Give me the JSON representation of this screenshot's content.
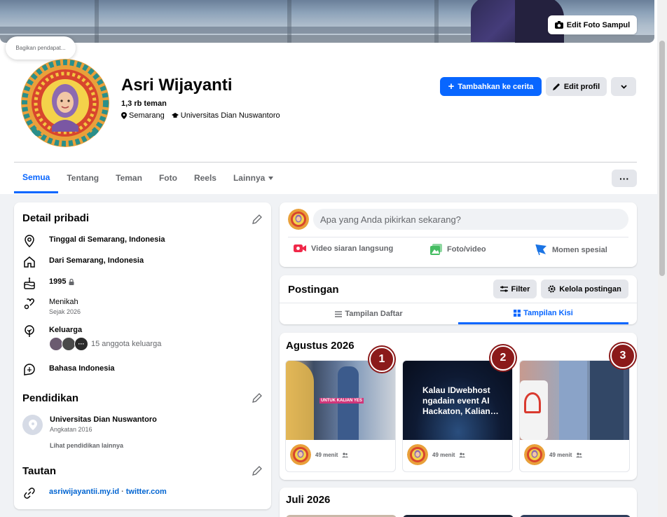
{
  "cover": {
    "edit_label": "Edit Foto Sampul"
  },
  "note": {
    "text": "Bagikan pendapat..."
  },
  "profile": {
    "name": "Asri Wijayanti",
    "friends": "1,3 rb teman",
    "location": "Semarang",
    "school": "Universitas Dian Nuswantoro"
  },
  "actions": {
    "add_story": "Tambahkan ke cerita",
    "edit_profile": "Edit profil"
  },
  "tabs": [
    "Semua",
    "Tentang",
    "Teman",
    "Foto",
    "Reels",
    "Lainnya"
  ],
  "details": {
    "title": "Detail pribadi",
    "lives": "Tinggal di Semarang, Indonesia",
    "from": "Dari Semarang, Indonesia",
    "birth_year": "1995",
    "relationship": "Menikah",
    "relationship_since": "Sejak 2026",
    "family_label": "Keluarga",
    "family_count": "15 anggota keluarga",
    "language": "Bahasa Indonesia"
  },
  "education": {
    "title": "Pendidikan",
    "school": "Universitas Dian Nuswantoro",
    "year": "Angkatan 2016",
    "more": "Lihat pendidikan lainnya"
  },
  "links": {
    "title": "Tautan",
    "link1": "asriwijayantii.my.id",
    "separator": "·",
    "link2": "twitter.com"
  },
  "composer": {
    "placeholder": "Apa yang Anda pikirkan sekarang?",
    "live": "Video siaran langsung",
    "photo": "Foto/video",
    "event": "Momen spesial"
  },
  "posts": {
    "title": "Postingan",
    "filter": "Filter",
    "manage": "Kelola postingan",
    "list_view": "Tampilan Daftar",
    "grid_view": "Tampilan Kisi"
  },
  "grid": {
    "month1": "Agustus 2026",
    "month2": "Juli 2026",
    "items": [
      {
        "badge": "1",
        "time": "49 menit",
        "caption": "UNTUK KALIAN YES"
      },
      {
        "badge": "2",
        "time": "49 menit",
        "caption": "Kalau IDwebhost ngadain event AI Hackaton, Kalian…"
      },
      {
        "badge": "3",
        "time": "49 menit",
        "caption": ""
      }
    ]
  },
  "colors": {
    "accent": "#0866ff",
    "badge": "#8b1a1a",
    "live": "#f02849",
    "photo": "#45bd62",
    "event": "#1b74e4"
  }
}
